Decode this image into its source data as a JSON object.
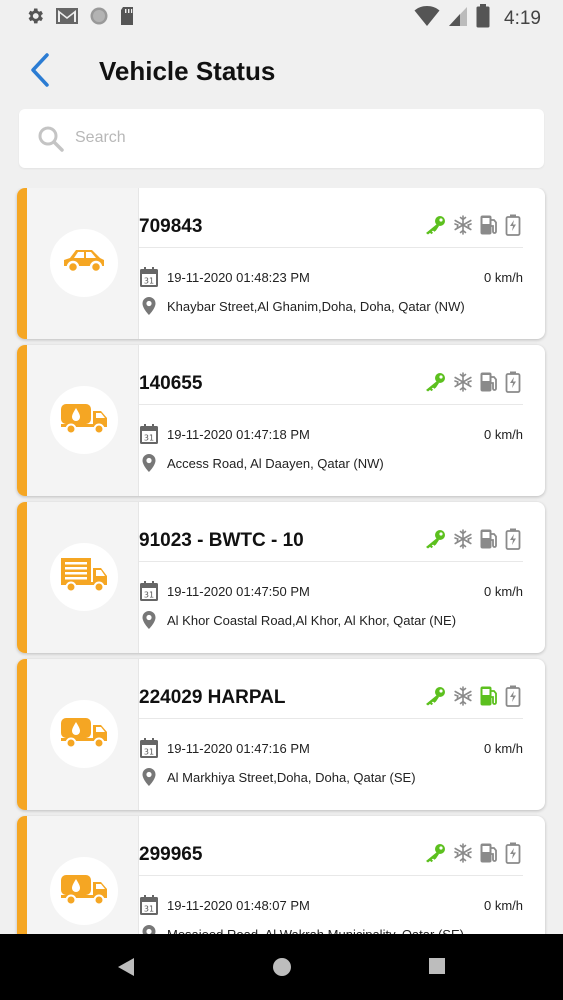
{
  "status_bar": {
    "time": "4:19",
    "left_icons": [
      "settings-icon",
      "gmail-icon",
      "circle-icon",
      "sd-card-icon"
    ],
    "right_icons": [
      "wifi-icon",
      "signal-icon",
      "battery-icon"
    ]
  },
  "header": {
    "title": "Vehicle Status"
  },
  "search": {
    "placeholder": "Search",
    "value": ""
  },
  "colors": {
    "accent": "#f5a623",
    "active": "#5cc01e",
    "inactive": "#8a8a8a",
    "back": "#2b7cd3"
  },
  "vehicles": [
    {
      "name": "709843",
      "vehicle_icon": "car-icon",
      "datetime": "19-11-2020 01:48:23 PM",
      "speed": "0 km/h",
      "address": "Khaybar Street,Al Ghanim,Doha, Doha, Qatar (NW)",
      "ignition": "active",
      "ac": "inactive",
      "fuel": "inactive",
      "battery": "inactive"
    },
    {
      "name": "140655",
      "vehicle_icon": "tanker-truck-icon",
      "datetime": "19-11-2020 01:47:18 PM",
      "speed": "0 km/h",
      "address": "Access Road, Al Daayen, Qatar (NW)",
      "ignition": "active",
      "ac": "inactive",
      "fuel": "inactive",
      "battery": "inactive"
    },
    {
      "name": "91023 - BWTC - 10",
      "vehicle_icon": "cargo-truck-icon",
      "datetime": "19-11-2020 01:47:50 PM",
      "speed": "0 km/h",
      "address": "Al Khor Coastal Road,Al Khor, Al Khor, Qatar (NE)",
      "ignition": "active",
      "ac": "inactive",
      "fuel": "inactive",
      "battery": "inactive"
    },
    {
      "name": "224029 HARPAL",
      "vehicle_icon": "tanker-truck-icon",
      "datetime": "19-11-2020 01:47:16 PM",
      "speed": "0 km/h",
      "address": "Al Markhiya Street,Doha, Doha, Qatar (SE)",
      "ignition": "active",
      "ac": "inactive",
      "fuel": "active",
      "battery": "inactive"
    },
    {
      "name": "299965",
      "vehicle_icon": "tanker-truck-icon",
      "datetime": "19-11-2020 01:48:07 PM",
      "speed": "0 km/h",
      "address": "Mesaieed Road, Al Wakrah Municipality, Qatar (SE)",
      "ignition": "active",
      "ac": "inactive",
      "fuel": "inactive",
      "battery": "inactive"
    }
  ]
}
